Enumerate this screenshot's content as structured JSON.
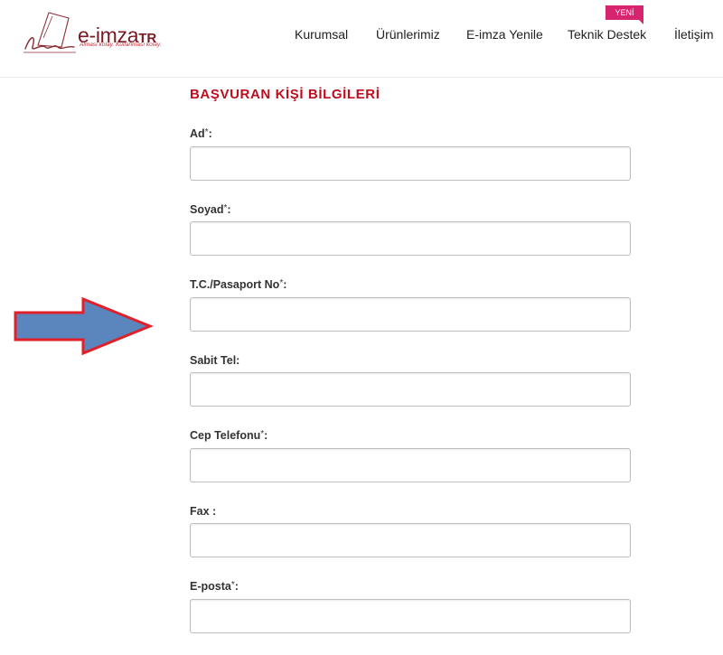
{
  "brand": {
    "name_main": "e-imza",
    "name_suffix": "TR",
    "slogan": "Alması kolay. Kullanması kolay.",
    "colors": {
      "primary": "#7a1a24",
      "accent": "#c00d1e",
      "badge": "#d6246e"
    }
  },
  "nav": {
    "items": [
      {
        "label": "Kurumsal"
      },
      {
        "label": "Ürünlerimiz"
      },
      {
        "label": "E-imza Yenile"
      },
      {
        "label": "Teknik Destek",
        "badge": "YENİ"
      },
      {
        "label": "İletişim"
      }
    ]
  },
  "form": {
    "title": "BAŞVURAN KİŞİ BİLGİLERİ",
    "fields": [
      {
        "label": "Ad",
        "required": "*",
        "suffix": ":",
        "value": ""
      },
      {
        "label": "Soyad",
        "required": "*",
        "suffix": ":",
        "value": ""
      },
      {
        "label": "T.C./Pasaport No",
        "required": "*",
        "suffix": ":",
        "value": ""
      },
      {
        "label": "Sabit Tel",
        "required": "",
        "suffix": ":",
        "value": ""
      },
      {
        "label": "Cep Telefonu",
        "required": "*",
        "suffix": ":",
        "value": ""
      },
      {
        "label": "Fax ",
        "required": "",
        "suffix": ":",
        "value": ""
      },
      {
        "label": "E-posta",
        "required": "*",
        "suffix": ":",
        "value": ""
      }
    ]
  },
  "annotation": {
    "icon": "right-arrow-icon",
    "fill": "#5b85bd",
    "stroke": "#e0212b"
  }
}
